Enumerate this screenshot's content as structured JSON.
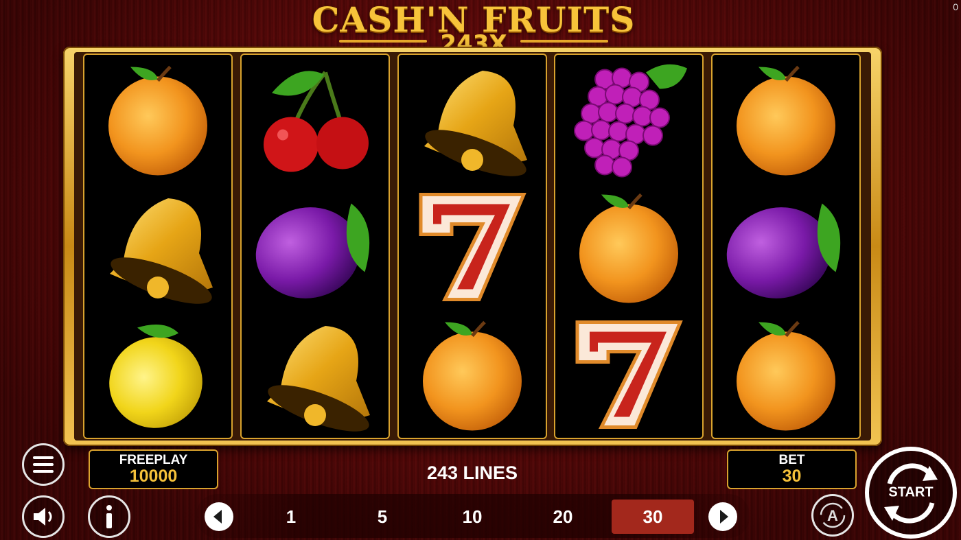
{
  "corner_counter": "0",
  "logo": {
    "title": "CASH'N FRUITS",
    "subtitle": "243X"
  },
  "reels": [
    [
      "orange-icon",
      "bell-icon",
      "lemon-icon"
    ],
    [
      "cherry-icon",
      "plum-icon",
      "bell-icon"
    ],
    [
      "bell-icon",
      "seven-icon",
      "orange-icon"
    ],
    [
      "grapes-icon",
      "orange-icon",
      "seven-icon"
    ],
    [
      "orange-icon",
      "plum-icon",
      "orange-icon"
    ]
  ],
  "freeplay": {
    "label": "FREEPLAY",
    "value": "10000"
  },
  "lines_text": "243 LINES",
  "bet": {
    "label": "BET",
    "value": "30"
  },
  "bet_options": [
    "1",
    "5",
    "10",
    "20",
    "30"
  ],
  "selected_bet": "30",
  "start_label": "START",
  "colors": {
    "gold": "#f5c13a",
    "selected": "#a3281c",
    "background": "#6c0d0d"
  }
}
